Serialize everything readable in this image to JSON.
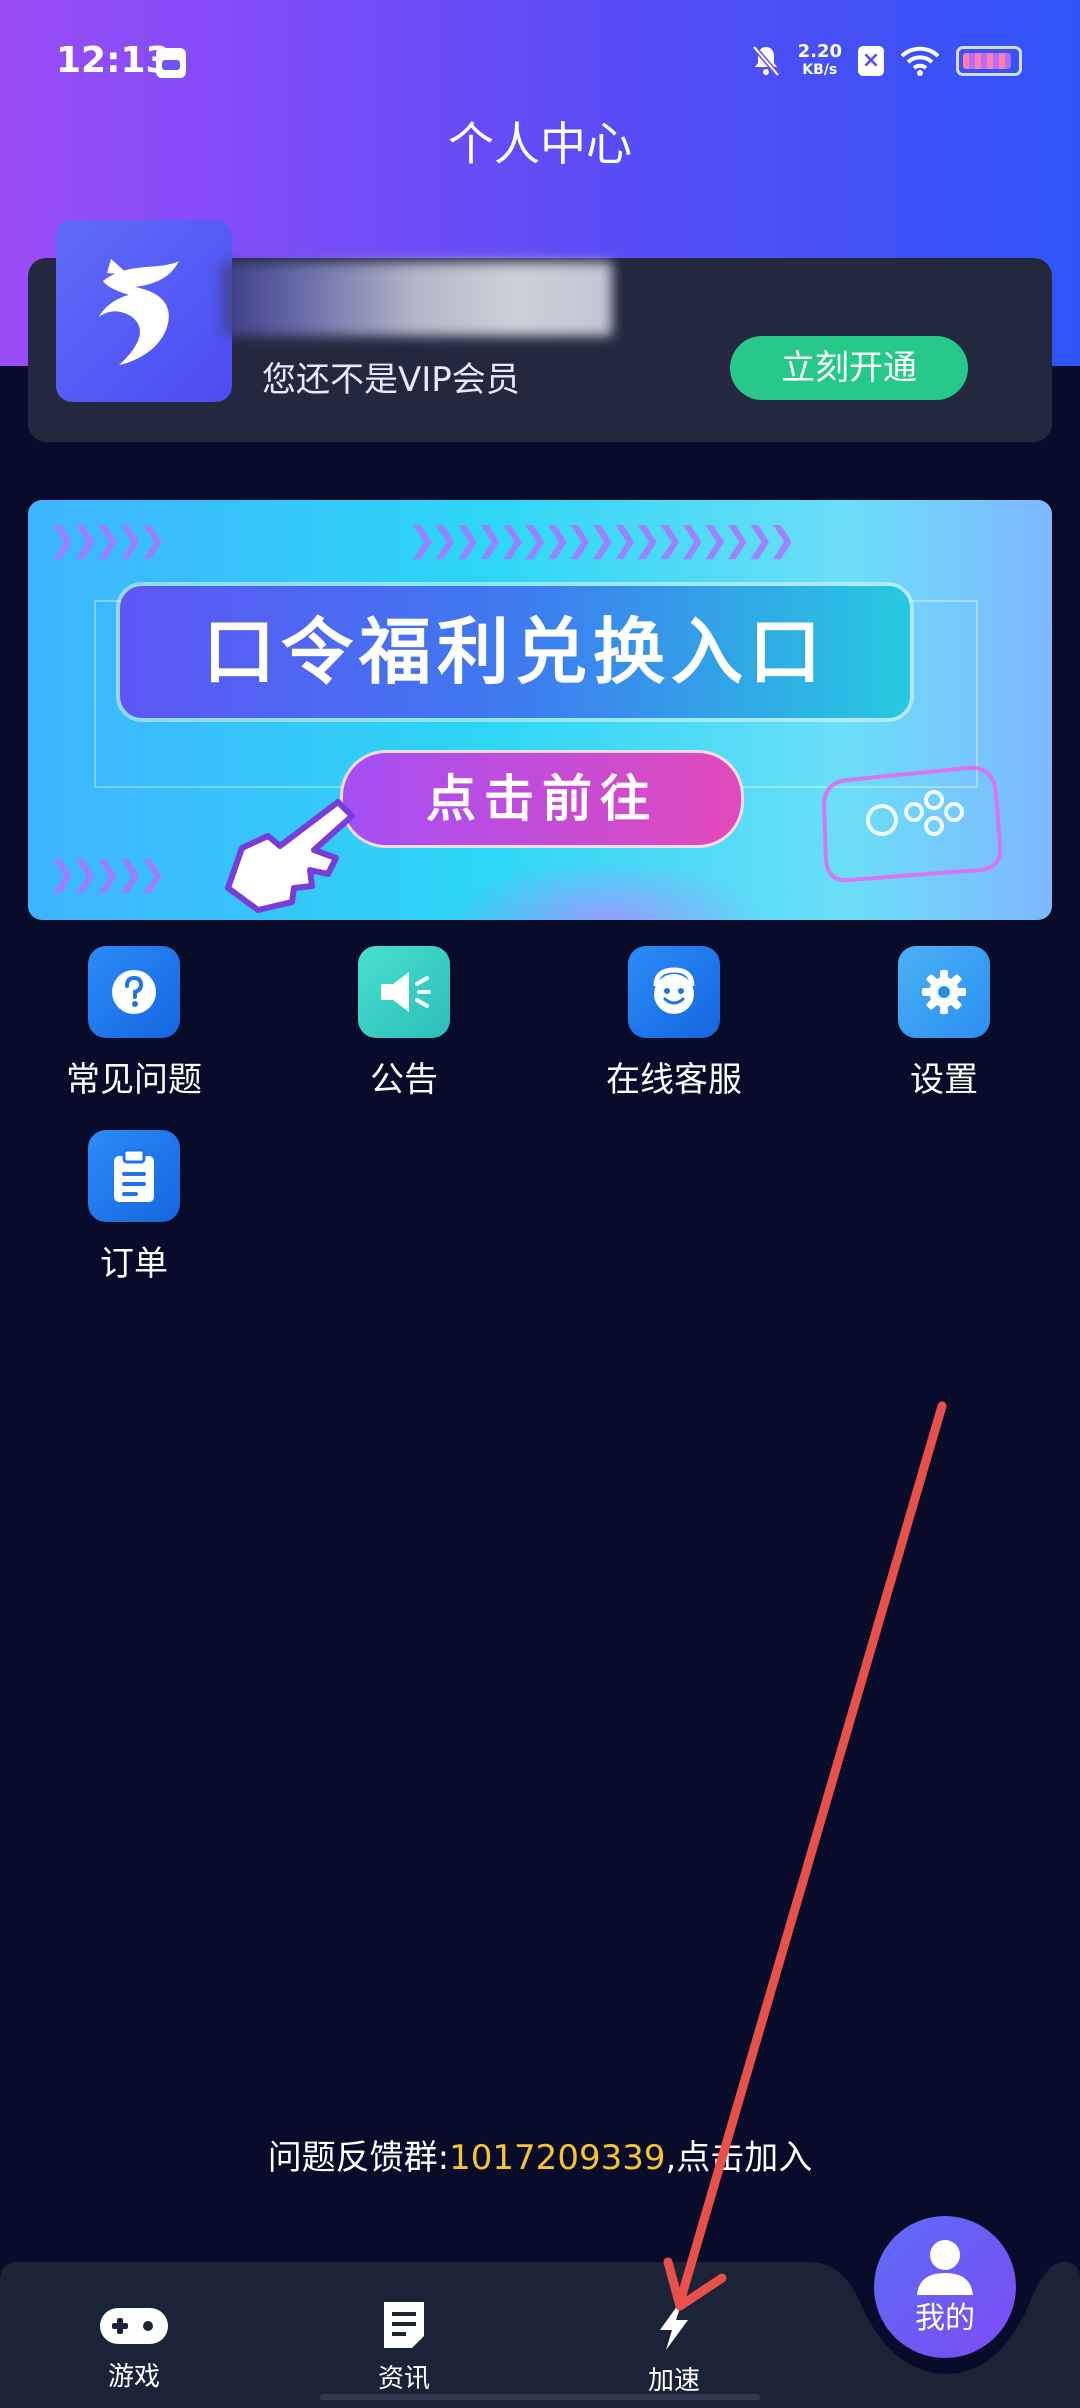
{
  "status_bar": {
    "time": "12:13",
    "net_speed": "2.20",
    "net_unit": "KB/s",
    "close_glyph": "×"
  },
  "page_title": "个人中心",
  "member": {
    "vip_status": "您还不是VIP会员",
    "open_vip_label": "立刻开通"
  },
  "banner": {
    "title": "口令福利兑换入口",
    "cta": "点击前往"
  },
  "menu": [
    {
      "label": "常见问题",
      "icon": "question-icon"
    },
    {
      "label": "公告",
      "icon": "megaphone-icon"
    },
    {
      "label": "在线客服",
      "icon": "customer-service-icon"
    },
    {
      "label": "设置",
      "icon": "gear-icon"
    },
    {
      "label": "订单",
      "icon": "clipboard-icon"
    }
  ],
  "feedback": {
    "prefix": "问题反馈群:",
    "number": "1017209339",
    "suffix": ",点击加入"
  },
  "tabs": [
    {
      "label": "游戏",
      "icon": "gamepad-icon"
    },
    {
      "label": "资讯",
      "icon": "news-icon"
    },
    {
      "label": "加速",
      "icon": "lightning-icon"
    },
    {
      "label": "我的",
      "icon": "user-icon",
      "active": true
    }
  ],
  "colors": {
    "header_start": "#9b4cf6",
    "header_end": "#2f54f6",
    "background": "#090b2b",
    "accent_green": "#27c98a",
    "link_yellow": "#f7c331",
    "annotation_arrow": "#e8504a"
  }
}
